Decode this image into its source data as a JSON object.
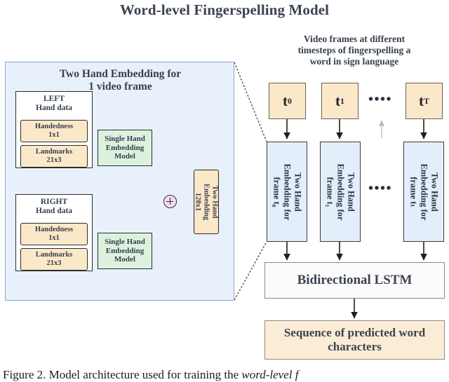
{
  "figure": {
    "title": "Word-level Fingerspelling Model",
    "caption_plain": "Figure 2. Model architecture used for training the ",
    "caption_italic": "word-level f"
  },
  "left_panel": {
    "title": "Two Hand Embedding for\n1 video frame",
    "title_line1": "Two Hand Embedding for",
    "title_line2": "1 video frame",
    "hands": [
      {
        "group_label_line1": "LEFT",
        "group_label_line2": "Hand data",
        "chips": [
          {
            "name_line1": "Handedness",
            "name_line2": "1x1"
          },
          {
            "name_line1": "Landmarks",
            "name_line2": "21x3"
          }
        ],
        "model_label": "Single Hand Embedding Model"
      },
      {
        "group_label_line1": "RIGHT",
        "group_label_line2": "Hand data",
        "chips": [
          {
            "name_line1": "Handedness",
            "name_line2": "1x1"
          },
          {
            "name_line1": "Landmarks",
            "name_line2": "21x3"
          }
        ],
        "model_label": "Single Hand Embedding Model"
      }
    ],
    "sum_node_symbol": "+",
    "two_hand_embedding": {
      "line1": "Two Hand",
      "line2": "Embedding",
      "line3": "128x1"
    }
  },
  "right_panel": {
    "video_frames_caption_line1": "Video frames at different",
    "video_frames_caption_line2": "timesteps of fingerspelling a",
    "video_frames_caption_line3": "word in sign language",
    "timesteps": [
      {
        "label": "t",
        "sub": "0"
      },
      {
        "label": "t",
        "sub": "1"
      },
      {
        "label": "t",
        "sub": "T"
      }
    ],
    "timestep_ellipsis": "••••",
    "frame_embeddings": [
      {
        "line1": "Two Hand",
        "line2": "Embedding for",
        "line3": "frame t₀"
      },
      {
        "line1": "Two Hand",
        "line2": "Embedding for",
        "line3": "frame t₁"
      },
      {
        "line1": "Two Hand",
        "line2": "Embedding for",
        "line3": "frame tₜ"
      }
    ],
    "frame_embedding_ellipsis": "••••",
    "lstm_label": "Bidirectional LSTM",
    "output_label": "Sequence of predicted word characters"
  },
  "colors": {
    "panel_bg": "#e8f0fb",
    "panel_border": "#8fa9cf",
    "chip_bg": "#fbe8c8",
    "model_bg": "#ddf2dd",
    "sum_bg": "#f6ddf3",
    "frame_box_bg": "#e4eefb",
    "output_bg": "#fbecd5",
    "text": "#363f4d"
  }
}
